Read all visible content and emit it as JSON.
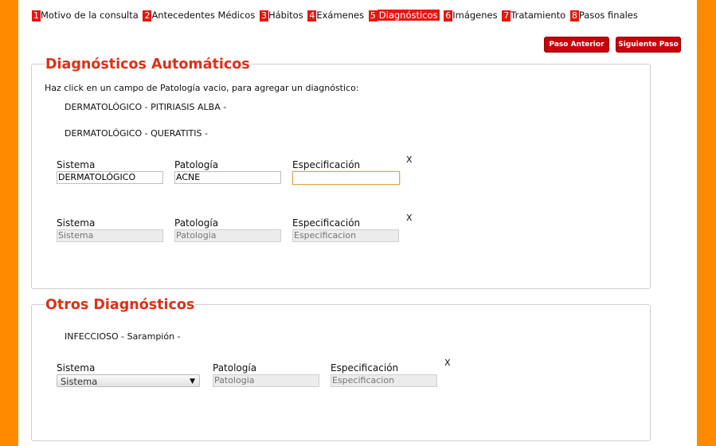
{
  "steps": [
    {
      "num": "1",
      "label": "Motivo de la consulta"
    },
    {
      "num": "2",
      "label": "Antecedentes Médicos"
    },
    {
      "num": "3",
      "label": "Hábitos"
    },
    {
      "num": "4",
      "label": "Exámenes"
    },
    {
      "num": "5",
      "label": "Diagnósticos"
    },
    {
      "num": "6",
      "label": "Imágenes"
    },
    {
      "num": "7",
      "label": "Tratamiento"
    },
    {
      "num": "8",
      "label": "Pasos finales"
    }
  ],
  "buttons": {
    "prev": "Paso Anterior",
    "next": "Siguiente Paso"
  },
  "auto": {
    "title": "Diagnósticos Automáticos",
    "hint": "Haz click en un campo de Patología vacio, para agregar un diagnóstico:",
    "existing": [
      "DERMATOLÓGICO - PITIRIASIS ALBA -",
      "DERMATOLÓGICO - QUERATITIS -"
    ],
    "rows": [
      {
        "sistema_label": "Sistema",
        "patologia_label": "Patología",
        "especificacion_label": "Especificación",
        "sistema_value": "DERMATOLÓGICO",
        "patologia_value": "ACNE",
        "especificacion_value": "",
        "remove": "X"
      },
      {
        "sistema_label": "Sistema",
        "patologia_label": "Patología",
        "especificacion_label": "Especificación",
        "sistema_placeholder": "Sistema",
        "patologia_placeholder": "Patologia",
        "especificacion_placeholder": "Especificacion",
        "remove": "X"
      }
    ]
  },
  "otros": {
    "title": "Otros Diagnósticos",
    "existing": [
      "INFECCIOSO - Sarampión -"
    ],
    "row": {
      "sistema_label": "Sistema",
      "patologia_label": "Patología",
      "especificacion_label": "Especificación",
      "sistema_selected": "Sistema",
      "patologia_placeholder": "Patologia",
      "especificacion_placeholder": "Especificacion",
      "remove": "X"
    }
  },
  "colors": {
    "accent": "#e5170f",
    "title": "#d9321a",
    "frame": "#ff8a00",
    "button": "#c8000a"
  }
}
